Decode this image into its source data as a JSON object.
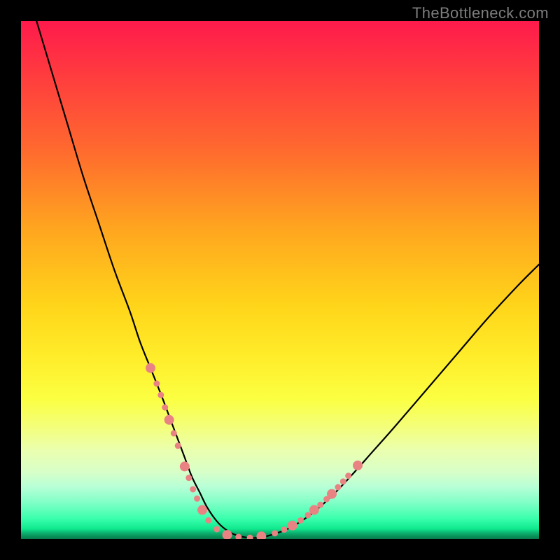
{
  "watermark": {
    "text": "TheBottleneck.com"
  },
  "chart_data": {
    "type": "line",
    "title": "",
    "xlabel": "",
    "ylabel": "",
    "xlim": [
      0,
      100
    ],
    "ylim": [
      0,
      100
    ],
    "grid": false,
    "legend": false,
    "series": [
      {
        "name": "curve",
        "stroke": "#000000",
        "stroke_width": 2.2,
        "x": [
          3,
          6,
          9,
          12,
          15,
          18,
          21,
          23,
          25,
          27,
          28.5,
          30,
          31.5,
          33,
          34.5,
          36,
          38,
          40,
          42,
          45,
          48,
          52,
          56,
          60,
          64,
          68,
          72,
          78,
          84,
          90,
          96,
          100
        ],
        "y": [
          100,
          90,
          80,
          70,
          61,
          52,
          44,
          38,
          33,
          28,
          24,
          20,
          16,
          12,
          9,
          6,
          3.2,
          1.5,
          0.6,
          0.2,
          0.7,
          2.2,
          4.8,
          8.3,
          12.5,
          17,
          21.5,
          28.5,
          35.5,
          42.5,
          49,
          53
        ]
      }
    ],
    "highlight_points": {
      "color": "#e98383",
      "radius_small": 4.5,
      "radius_large": 7.0,
      "points": [
        {
          "x": 25.0,
          "y": 33.0,
          "r": "large"
        },
        {
          "x": 26.2,
          "y": 30.0,
          "r": "small"
        },
        {
          "x": 27.0,
          "y": 27.8,
          "r": "small"
        },
        {
          "x": 27.8,
          "y": 25.4,
          "r": "small"
        },
        {
          "x": 28.6,
          "y": 23.0,
          "r": "large"
        },
        {
          "x": 29.5,
          "y": 20.4,
          "r": "small"
        },
        {
          "x": 30.3,
          "y": 18.0,
          "r": "small"
        },
        {
          "x": 31.6,
          "y": 14.0,
          "r": "large"
        },
        {
          "x": 32.4,
          "y": 11.8,
          "r": "small"
        },
        {
          "x": 33.2,
          "y": 9.6,
          "r": "small"
        },
        {
          "x": 34.0,
          "y": 7.8,
          "r": "small"
        },
        {
          "x": 35.0,
          "y": 5.6,
          "r": "large"
        },
        {
          "x": 36.2,
          "y": 3.6,
          "r": "small"
        },
        {
          "x": 37.8,
          "y": 1.9,
          "r": "small"
        },
        {
          "x": 39.8,
          "y": 0.8,
          "r": "large"
        },
        {
          "x": 42.0,
          "y": 0.4,
          "r": "small"
        },
        {
          "x": 44.2,
          "y": 0.25,
          "r": "small"
        },
        {
          "x": 46.4,
          "y": 0.5,
          "r": "large"
        },
        {
          "x": 49.0,
          "y": 1.1,
          "r": "small"
        },
        {
          "x": 50.8,
          "y": 1.8,
          "r": "small"
        },
        {
          "x": 52.4,
          "y": 2.6,
          "r": "large"
        },
        {
          "x": 54.0,
          "y": 3.6,
          "r": "small"
        },
        {
          "x": 55.4,
          "y": 4.6,
          "r": "small"
        },
        {
          "x": 56.6,
          "y": 5.6,
          "r": "large"
        },
        {
          "x": 57.8,
          "y": 6.6,
          "r": "small"
        },
        {
          "x": 59.0,
          "y": 7.7,
          "r": "small"
        },
        {
          "x": 60.0,
          "y": 8.7,
          "r": "large"
        },
        {
          "x": 61.2,
          "y": 10.0,
          "r": "small"
        },
        {
          "x": 62.2,
          "y": 11.1,
          "r": "small"
        },
        {
          "x": 63.2,
          "y": 12.2,
          "r": "small"
        },
        {
          "x": 65.0,
          "y": 14.2,
          "r": "large"
        }
      ]
    }
  }
}
